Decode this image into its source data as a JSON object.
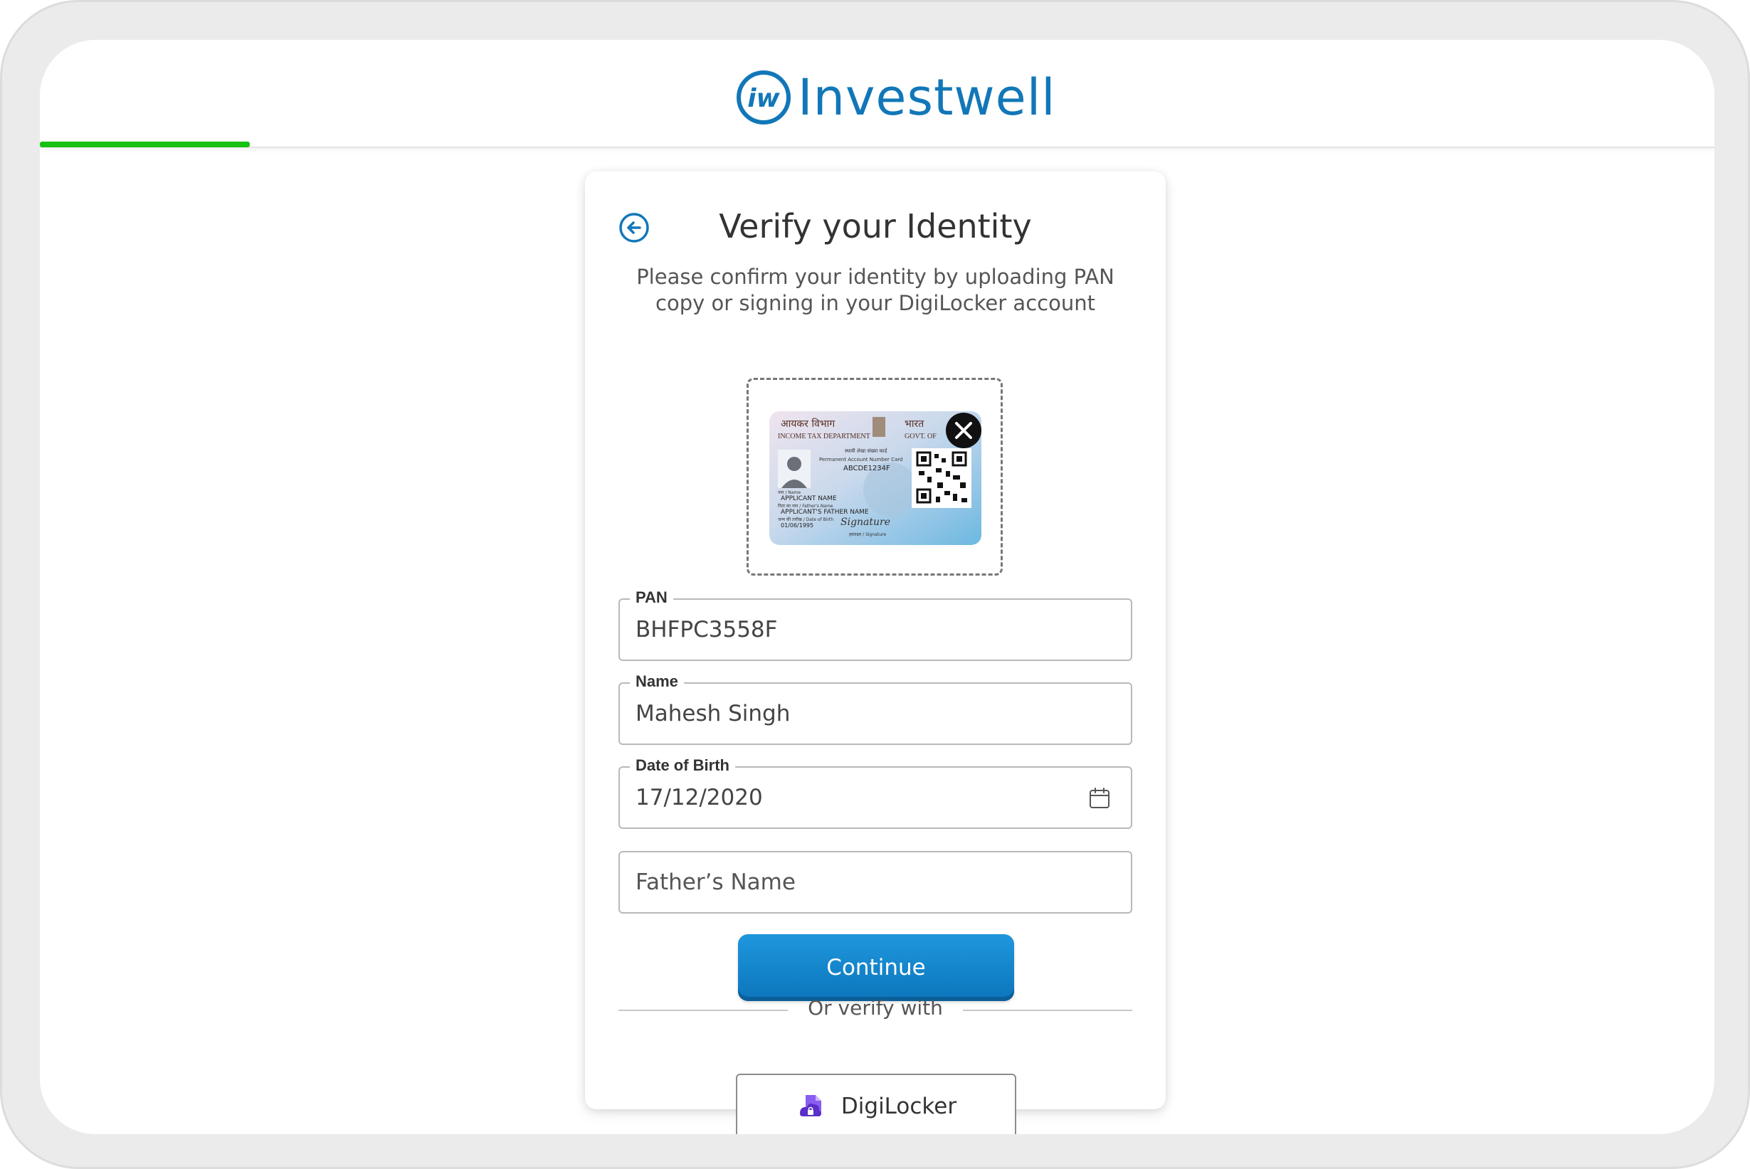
{
  "header": {
    "brand": "Investwell",
    "logo_mark": "iw",
    "progress_percent": 8
  },
  "form": {
    "title": "Verify your Identity",
    "subtitle": "Please confirm your identity by uploading PAN copy or signing in your DigiLocker account",
    "pan_card_preview": {
      "header_hi": "आयकर विभाग",
      "header_hi_right": "भारत",
      "dept": "INCOME TAX DEPARTMENT",
      "govt": "GOVT. OF",
      "card_title_hi": "स्थायी लेखा संख्या कार्ड",
      "card_title": "Permanent Account Number Card",
      "number": "ABCDE1234F",
      "name_label": "नाम / Name",
      "name": "APPLICANT NAME",
      "father_label": "पिता का नाम / Father's Name",
      "father": "APPLICANT'S FATHER NAME",
      "dob_label": "जन्म की तारीख / Date of Birth",
      "dob": "01/06/1995",
      "signature_label": "हस्ताक्षर / Signature",
      "signature": "Signature"
    },
    "fields": {
      "pan": {
        "label": "PAN",
        "value": "BHFPC3558F"
      },
      "name": {
        "label": "Name",
        "value": "Mahesh Singh"
      },
      "dob": {
        "label": "Date of Birth",
        "value": "17/12/2020"
      },
      "father": {
        "placeholder": "Father’s Name",
        "value": ""
      }
    },
    "continue_label": "Continue",
    "divider_text": "Or verify with",
    "digilocker_label": "DigiLocker"
  },
  "colors": {
    "accent": "#1277b8",
    "button": "#1a8ad0",
    "progress": "#16c112",
    "digilocker": "#6f3fd6"
  },
  "icons": {
    "back": "arrow-left-circle-icon",
    "remove": "close-circle-icon",
    "calendar": "calendar-icon",
    "digilocker": "digilocker-icon"
  }
}
